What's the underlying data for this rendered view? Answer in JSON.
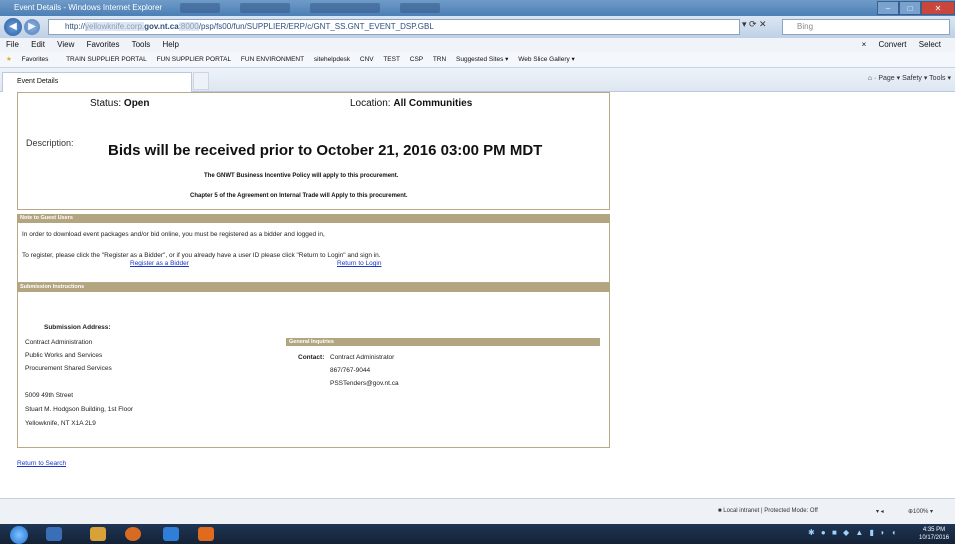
{
  "window": {
    "title": "Event Details - Windows Internet Explorer",
    "min": "–",
    "max": "□",
    "close": "✕"
  },
  "address": {
    "url_prefix": "http://",
    "url_host": "gov.nt.ca",
    "url_path": "psp/fs00/fun/SUPPLIER/ERP/c/GNT_SS.GNT_EVENT_DSP.GBL",
    "search_placeholder": "Bing"
  },
  "menu": {
    "items": [
      "File",
      "Edit",
      "View",
      "Favorites",
      "Tools",
      "Help"
    ],
    "convert": "Convert",
    "select": "Select"
  },
  "favorites": {
    "label": "Favorites",
    "items": [
      "TRAIN SUPPLIER PORTAL",
      "FUN SUPPLIER PORTAL",
      "FUN ENVIRONMENT",
      "sitehelpdesk",
      "CNV",
      "TEST",
      "CSP",
      "TRN",
      "Suggested Sites ▾",
      "Web Slice Gallery ▾"
    ]
  },
  "tabs": {
    "active": "Event Details",
    "commands": "Page ▾   Safety ▾   Tools ▾"
  },
  "event": {
    "status_label": "Status:",
    "status_value": "Open",
    "location_label": "Location:",
    "location_value": "All Communities",
    "description_label": "Description:",
    "bids_line": "Bids will be received prior to October 21, 2016 03:00 PM MDT",
    "policy_line": "The GNWT Business Incentive Policy will apply to this procurement.",
    "chapter_line": "Chapter 5 of the Agreement on Internal Trade will Apply to this procurement."
  },
  "guest": {
    "header": "Note to Guest Users",
    "line1": "In order to download event packages and/or bid online, you must be registered as a bidder and logged in,",
    "line2": "To register, please click the \"Register as a Bidder\", or if you already have a user ID please click \"Return to Login\" and sign in.",
    "register_link": "Register as a Bidder",
    "login_link": "Return to Login"
  },
  "submission": {
    "header": "Submission Instructions",
    "address_label": "Submission Address:",
    "lines": [
      "Contract Administration",
      "Public Works and Services",
      "Procurement Shared Services"
    ],
    "street_lines": [
      "5009 49th Street",
      "Stuart M. Hodgson Building, 1st Floor",
      "Yellowknife, NT  X1A 2L9"
    ]
  },
  "inquiries": {
    "header": "General Inquiries",
    "contact_label": "Contact:",
    "contact_lines": [
      "Contract Administrator",
      "867/767-9044",
      "PSSTenders@gov.nt.ca"
    ]
  },
  "footer": {
    "return_search": "Return to Search"
  },
  "statusbar": {
    "zone": "Local intranet | Protected Mode: Off",
    "zoom": "100%"
  },
  "taskbar": {
    "time": "4:35 PM",
    "date": "10/17/2016"
  }
}
